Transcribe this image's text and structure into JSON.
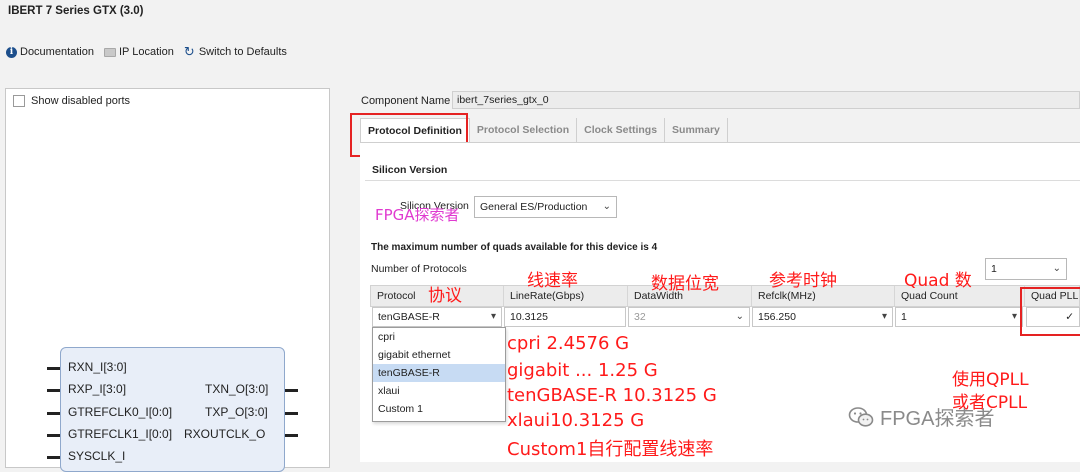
{
  "window": {
    "title": "IBERT 7 Series GTX (3.0)"
  },
  "toolbar": {
    "documentation": "Documentation",
    "ip_location": "IP Location",
    "switch_defaults": "Switch to Defaults"
  },
  "left_panel": {
    "show_disabled_ports": "Show disabled ports",
    "pins_left": [
      "RXN_I[3:0]",
      "RXP_I[3:0]",
      "GTREFCLK0_I[0:0]",
      "GTREFCLK1_I[0:0]",
      "SYSCLK_I"
    ],
    "pins_right": [
      "TXN_O[3:0]",
      "TXP_O[3:0]",
      "RXOUTCLK_O"
    ]
  },
  "component": {
    "label": "Component Name",
    "value": "ibert_7series_gtx_0"
  },
  "tabs": [
    {
      "label": "Protocol Definition",
      "active": true
    },
    {
      "label": "Protocol Selection",
      "active": false
    },
    {
      "label": "Clock Settings",
      "active": false
    },
    {
      "label": "Summary",
      "active": false
    }
  ],
  "silicon": {
    "section_title": "Silicon Version",
    "label": "Silicon Version",
    "value": "General ES/Production"
  },
  "max_quads_note": "The maximum number of quads available for this device is 4",
  "num_protocols": {
    "label": "Number of Protocols",
    "value": "1"
  },
  "table": {
    "headers": [
      "Protocol",
      "LineRate(Gbps)",
      "DataWidth",
      "Refclk(MHz)",
      "Quad Count",
      "Quad PLL"
    ],
    "row": {
      "protocol": "tenGBASE-R",
      "line_rate": "10.3125",
      "data_width": "32",
      "refclk": "156.250",
      "quad_count": "1",
      "quad_pll": "✓"
    }
  },
  "protocol_options": [
    "cpri",
    "gigabit ethernet",
    "tenGBASE-R",
    "xlaui",
    "Custom 1"
  ],
  "protocol_selected_index": 2,
  "annotations": {
    "protocol": "协议",
    "line_rate": "线速率",
    "data_width": "数据位宽",
    "refclk": "参考时钟",
    "quad_count": "Quad 数",
    "watermark_overlay": "FPGA探索者",
    "rates": [
      "cpri      2.4576  G",
      "gigabit ...      1.25 G",
      "tenGBASE-R      10.3125 G",
      "xlaui10.3125 G",
      "Custom1自行配置线速率"
    ],
    "qpll_line1": "使用QPLL",
    "qpll_line2": "或者CPLL"
  },
  "watermark": "FPGA探索者",
  "colors": {
    "annotation_red": "#ff1a1a",
    "selected_option": "#c7dbf3",
    "block_fill": "#e8eef8"
  },
  "icons": [
    "info-icon",
    "folder-icon",
    "refresh-icon",
    "chevron-down-icon",
    "checkbox-icon",
    "wechat-icon"
  ]
}
